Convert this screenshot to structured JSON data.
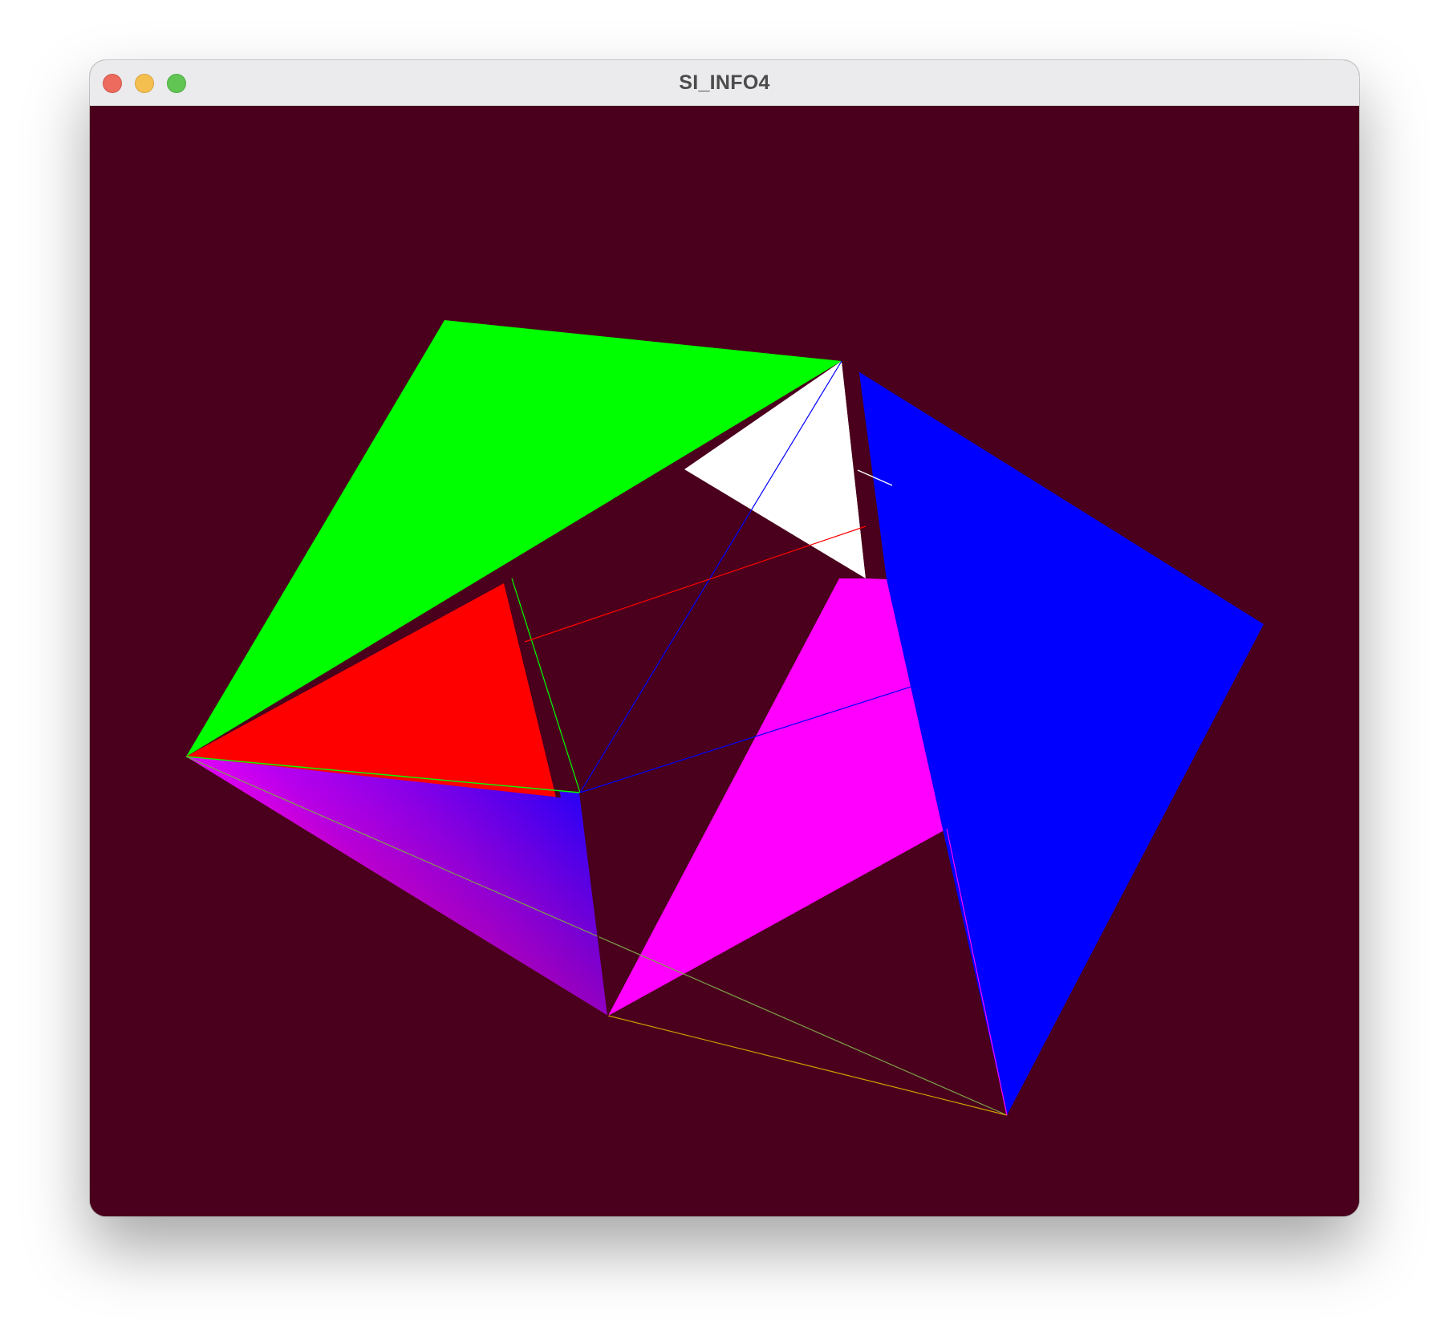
{
  "window": {
    "title": "SI_INFO4"
  },
  "controls": {
    "close": "close",
    "minimize": "minimize",
    "maximize": "maximize"
  },
  "viewport": {
    "background": "#4a001c",
    "shapes": [
      {
        "name": "green-face",
        "color": "#00ff00"
      },
      {
        "name": "white-face",
        "color": "#ffffff"
      },
      {
        "name": "blue-face",
        "color": "#0000ff"
      },
      {
        "name": "red-face",
        "color": "#ff0000"
      },
      {
        "name": "magenta-face",
        "color": "#ff00ff"
      },
      {
        "name": "gradient-face",
        "colors": [
          "#0000ff",
          "#ff00ff",
          "#ff0033"
        ]
      }
    ]
  }
}
